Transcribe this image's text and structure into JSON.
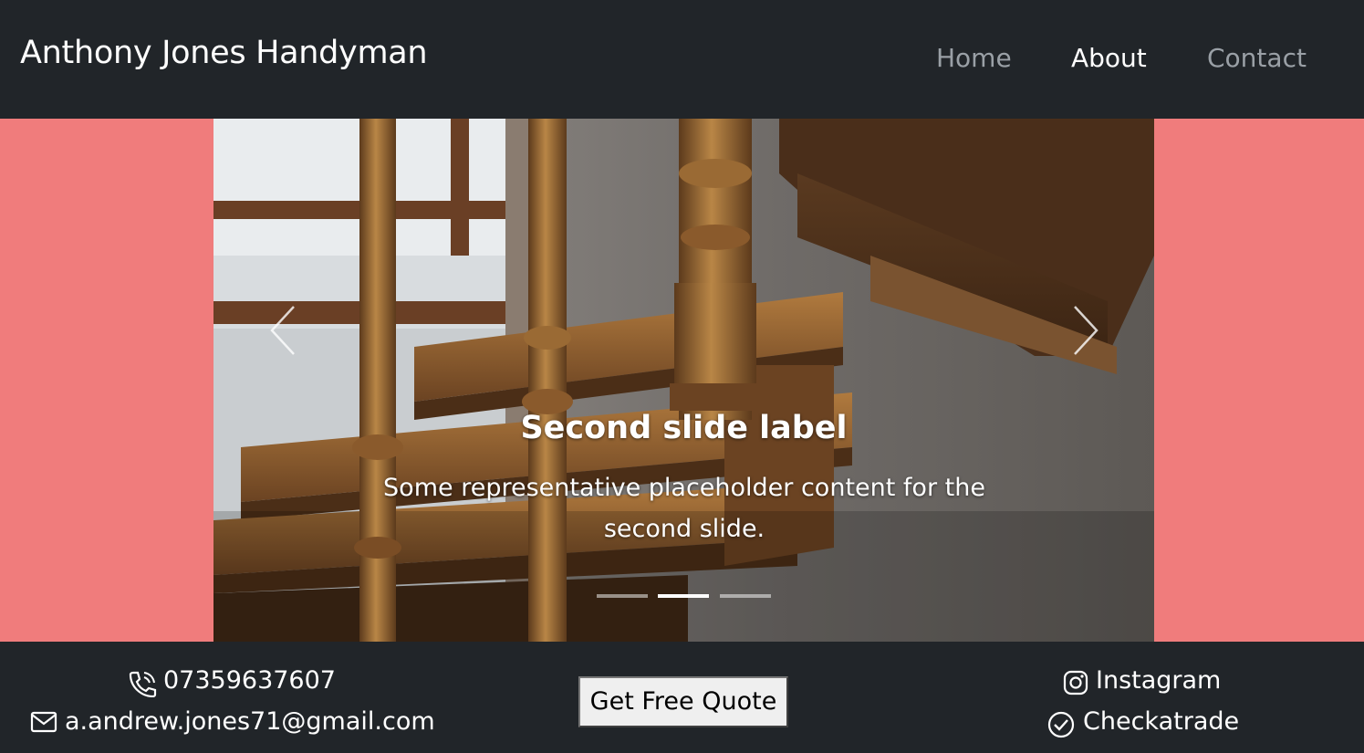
{
  "navbar": {
    "brand": "Anthony Jones Handyman",
    "links": [
      {
        "label": "Home",
        "active": false
      },
      {
        "label": "About",
        "active": true
      },
      {
        "label": "Contact",
        "active": false
      }
    ]
  },
  "carousel": {
    "slide_title": "Second slide label",
    "slide_text": "Some representative placeholder content for the second slide.",
    "active_index": 2,
    "slide_count": 3,
    "prev_icon": "chevron-left-icon",
    "next_icon": "chevron-right-icon"
  },
  "footer": {
    "phone": "07359637607",
    "email": "a.andrew.jones71@gmail.com",
    "quote_button": "Get Free Quote",
    "instagram": "Instagram",
    "checkatrade": "Checkatrade"
  },
  "colors": {
    "navbar_bg": "#212529",
    "page_bg": "#f07c7c",
    "nav_inactive": "#9aa0a6",
    "text": "#ffffff"
  }
}
